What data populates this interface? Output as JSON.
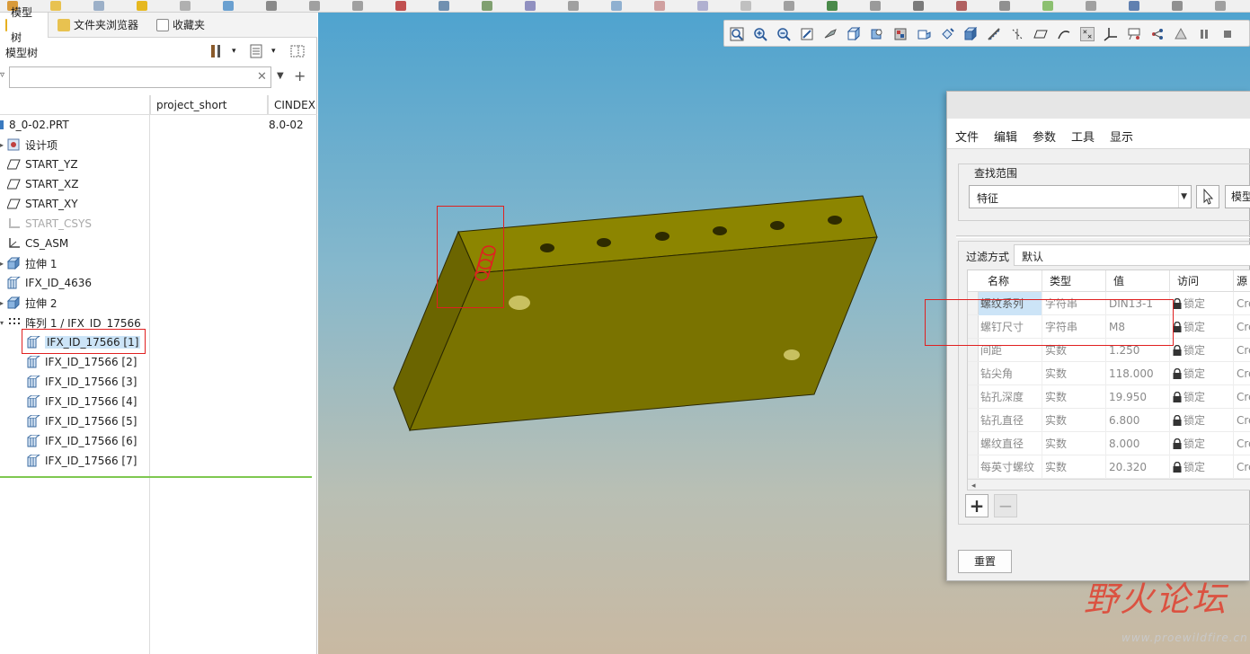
{
  "panel_tabs": [
    {
      "label": "模型树"
    },
    {
      "label": "文件夹浏览器"
    },
    {
      "label": "收藏夹"
    }
  ],
  "panel": {
    "title": "模型树"
  },
  "search": {
    "value": "",
    "placeholder": ""
  },
  "tree_columns": [
    "project_short",
    "CINDEX"
  ],
  "tree_items": [
    {
      "label": "8_0-02.PRT",
      "value": "8.0-02",
      "icon": "part-icon"
    },
    {
      "label": "设计项",
      "value": "",
      "icon": "design-items-icon"
    },
    {
      "label": "START_YZ",
      "value": "",
      "icon": "datum-plane-icon"
    },
    {
      "label": "START_XZ",
      "value": "",
      "icon": "datum-plane-icon"
    },
    {
      "label": "START_XY",
      "value": "",
      "icon": "datum-plane-icon"
    },
    {
      "label": "START_CSYS",
      "value": "",
      "icon": "csys-icon"
    },
    {
      "label": "CS_ASM",
      "value": "",
      "icon": "csys-icon"
    },
    {
      "label": "拉伸 1",
      "value": "",
      "icon": "extrude-icon"
    },
    {
      "label": "IFX_ID_4636",
      "value": "",
      "icon": "feature-icon"
    },
    {
      "label": "拉伸 2",
      "value": "",
      "icon": "extrude-icon"
    },
    {
      "label": "阵列 1 / IFX_ID_17566",
      "value": "",
      "icon": "pattern-icon"
    },
    {
      "label": "IFX_ID_17566 [1]",
      "value": "",
      "icon": "feature-icon"
    },
    {
      "label": "IFX_ID_17566 [2]",
      "value": "",
      "icon": "feature-icon"
    },
    {
      "label": "IFX_ID_17566 [3]",
      "value": "",
      "icon": "feature-icon"
    },
    {
      "label": "IFX_ID_17566 [4]",
      "value": "",
      "icon": "feature-icon"
    },
    {
      "label": "IFX_ID_17566 [5]",
      "value": "",
      "icon": "feature-icon"
    },
    {
      "label": "IFX_ID_17566 [6]",
      "value": "",
      "icon": "feature-icon"
    },
    {
      "label": "IFX_ID_17566 [7]",
      "value": "",
      "icon": "feature-icon"
    }
  ],
  "dialog": {
    "menu": [
      "文件",
      "编辑",
      "参数",
      "工具",
      "显示"
    ],
    "scope_label": "查找范围",
    "scope_value": "特征",
    "model_button": "模型",
    "filter_label": "过滤方式",
    "filter_value": "默认",
    "columns": [
      "名称",
      "类型",
      "值",
      "访问",
      "源"
    ],
    "rows": [
      {
        "name": "螺纹系列",
        "type": "字符串",
        "value": "DIN13-1",
        "access": "锁定",
        "source": "Cre"
      },
      {
        "name": "螺钉尺寸",
        "type": "字符串",
        "value": "M8",
        "access": "锁定",
        "source": "Cre"
      },
      {
        "name": "间距",
        "type": "实数",
        "value": "1.250",
        "access": "锁定",
        "source": "Cre"
      },
      {
        "name": "钻尖角",
        "type": "实数",
        "value": "118.000",
        "access": "锁定",
        "source": "Cre"
      },
      {
        "name": "钻孔深度",
        "type": "实数",
        "value": "19.950",
        "access": "锁定",
        "source": "Cre"
      },
      {
        "name": "钻孔直径",
        "type": "实数",
        "value": "6.800",
        "access": "锁定",
        "source": "Cre"
      },
      {
        "name": "螺纹直径",
        "type": "实数",
        "value": "8.000",
        "access": "锁定",
        "source": "Cre"
      },
      {
        "name": "每英寸螺纹",
        "type": "实数",
        "value": "20.320",
        "access": "锁定",
        "source": "Cre"
      }
    ],
    "reset_button": "重置"
  },
  "watermark": {
    "main": "野火论坛",
    "url": "www.proewildfire.cn"
  },
  "colors": {
    "part_face": "#7a7300",
    "part_top": "#8c8500",
    "part_side": "#6b6500",
    "selection_red": "#e02020",
    "tree_selection": "#cce4f7",
    "viewport_top": "#4fa3cf",
    "viewport_bottom": "#c9b9a2",
    "watermark_red": "#e04030"
  }
}
